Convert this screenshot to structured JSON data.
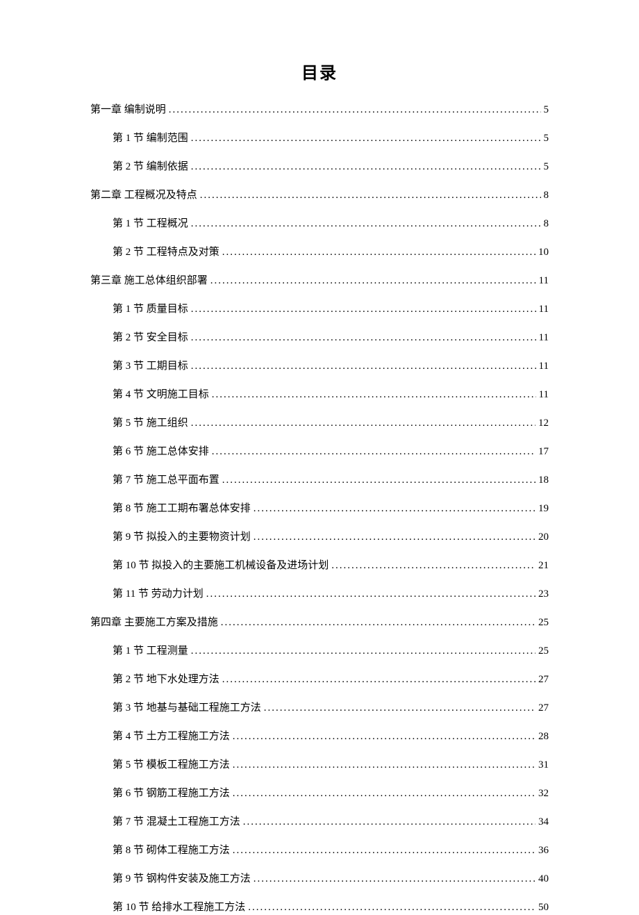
{
  "title": "目录",
  "entries": [
    {
      "level": 1,
      "label": "第一章  编制说明",
      "page": "5"
    },
    {
      "level": 2,
      "label": "第 1 节  编制范围",
      "page": "5"
    },
    {
      "level": 2,
      "label": "第 2 节  编制依据",
      "page": "5"
    },
    {
      "level": 1,
      "label": "第二章  工程概况及特点",
      "page": "8"
    },
    {
      "level": 2,
      "label": "第 1 节  工程概况",
      "page": "8"
    },
    {
      "level": 2,
      "label": "第 2 节  工程特点及对策",
      "page": "10"
    },
    {
      "level": 1,
      "label": "第三章  施工总体组织部署",
      "page": "11"
    },
    {
      "level": 2,
      "label": "第 1 节  质量目标",
      "page": "11"
    },
    {
      "level": 2,
      "label": "第 2 节  安全目标",
      "page": "11"
    },
    {
      "level": 2,
      "label": "第 3 节  工期目标",
      "page": "11"
    },
    {
      "level": 2,
      "label": "第 4 节  文明施工目标",
      "page": "11"
    },
    {
      "level": 2,
      "label": "第 5 节  施工组织",
      "page": "12"
    },
    {
      "level": 2,
      "label": "第 6 节  施工总体安排",
      "page": "17"
    },
    {
      "level": 2,
      "label": "第 7 节  施工总平面布置",
      "page": "18"
    },
    {
      "level": 2,
      "label": "第 8 节  施工工期布署总体安排",
      "page": "19"
    },
    {
      "level": 2,
      "label": "第 9 节  拟投入的主要物资计划",
      "page": "20"
    },
    {
      "level": 2,
      "label": "第 10 节  拟投入的主要施工机械设备及进场计划",
      "page": "21"
    },
    {
      "level": 2,
      "label": "第 11 节  劳动力计划",
      "page": "23"
    },
    {
      "level": 1,
      "label": "第四章  主要施工方案及措施",
      "page": "25"
    },
    {
      "level": 2,
      "label": "第 1 节  工程测量",
      "page": "25"
    },
    {
      "level": 2,
      "label": "第 2 节  地下水处理方法",
      "page": "27"
    },
    {
      "level": 2,
      "label": "第 3 节  地基与基础工程施工方法",
      "page": "27"
    },
    {
      "level": 2,
      "label": "第 4 节  土方工程施工方法",
      "page": "28"
    },
    {
      "level": 2,
      "label": "第 5 节  模板工程施工方法",
      "page": "31"
    },
    {
      "level": 2,
      "label": "第 6 节  钢筋工程施工方法",
      "page": "32"
    },
    {
      "level": 2,
      "label": "第 7 节  混凝土工程施工方法",
      "page": "34"
    },
    {
      "level": 2,
      "label": "第 8 节  砌体工程施工方法",
      "page": "36"
    },
    {
      "level": 2,
      "label": "第 9 节  钢构件安装及施工方法",
      "page": "40"
    },
    {
      "level": 2,
      "label": "第 10 节  给排水工程施工方法",
      "page": "50"
    }
  ]
}
